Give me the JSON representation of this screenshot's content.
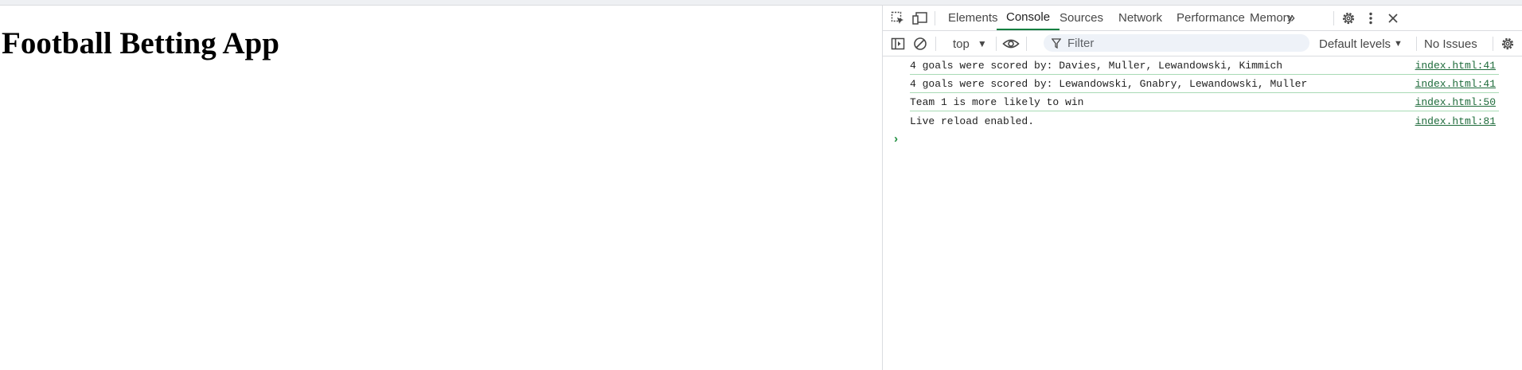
{
  "page": {
    "heading": "Football Betting App"
  },
  "devtools": {
    "tabs": [
      {
        "label": "Elements"
      },
      {
        "label": "Console"
      },
      {
        "label": "Sources"
      },
      {
        "label": "Network"
      },
      {
        "label": "Performance"
      },
      {
        "label": "Memory"
      }
    ],
    "active_tab": "Console",
    "more_tabs_glyph": "»",
    "toolbar": {
      "context": "top",
      "filter_placeholder": "Filter",
      "levels": "Default levels",
      "issues": "No Issues"
    },
    "console_messages": [
      {
        "text": "4 goals were scored by: Davies, Muller, Lewandowski, Kimmich",
        "source": "index.html:41"
      },
      {
        "text": "4 goals were scored by: Lewandowski, Gnabry, Lewandowski, Muller",
        "source": "index.html:41"
      },
      {
        "text": "Team 1 is more likely to win",
        "source": "index.html:50"
      },
      {
        "text": "Live reload enabled.",
        "source": "index.html:81"
      }
    ],
    "prompt_glyph": "›",
    "icons": {
      "inspect": "inspect-element-icon",
      "device": "device-toolbar-icon",
      "settings": "gear-icon",
      "menu": "kebab-menu-icon",
      "close": "close-icon",
      "sidebar": "sidebar-toggle-icon",
      "clear": "clear-console-icon",
      "eye": "live-expression-eye-icon",
      "filter": "filter-funnel-icon",
      "console_settings": "console-settings-gear-icon"
    }
  }
}
